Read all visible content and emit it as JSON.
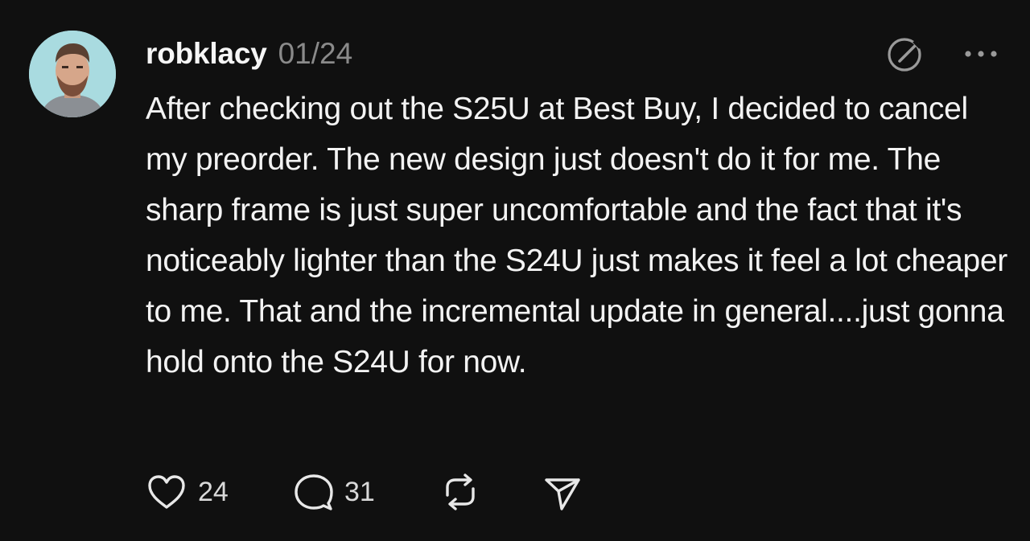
{
  "post": {
    "username": "robklacy",
    "date": "01/24",
    "text": "After checking out the S25U at Best Buy, I decided to cancel my preorder. The new design just doesn't do it for me. The sharp frame is just super uncomfortable and the fact that it's noticeably lighter than the S24U just makes it feel a lot cheaper to me. That and the incremental update in general....just gonna hold onto the S24U for now.",
    "likes": "24",
    "replies": "31"
  },
  "icons": {
    "header": [
      "edit-circle-icon",
      "more-icon"
    ],
    "actions": [
      "heart-icon",
      "comment-icon",
      "repost-icon",
      "share-icon"
    ]
  },
  "colors": {
    "background": "#101010",
    "text": "#f3f3f3",
    "muted": "#8a8a8a"
  }
}
